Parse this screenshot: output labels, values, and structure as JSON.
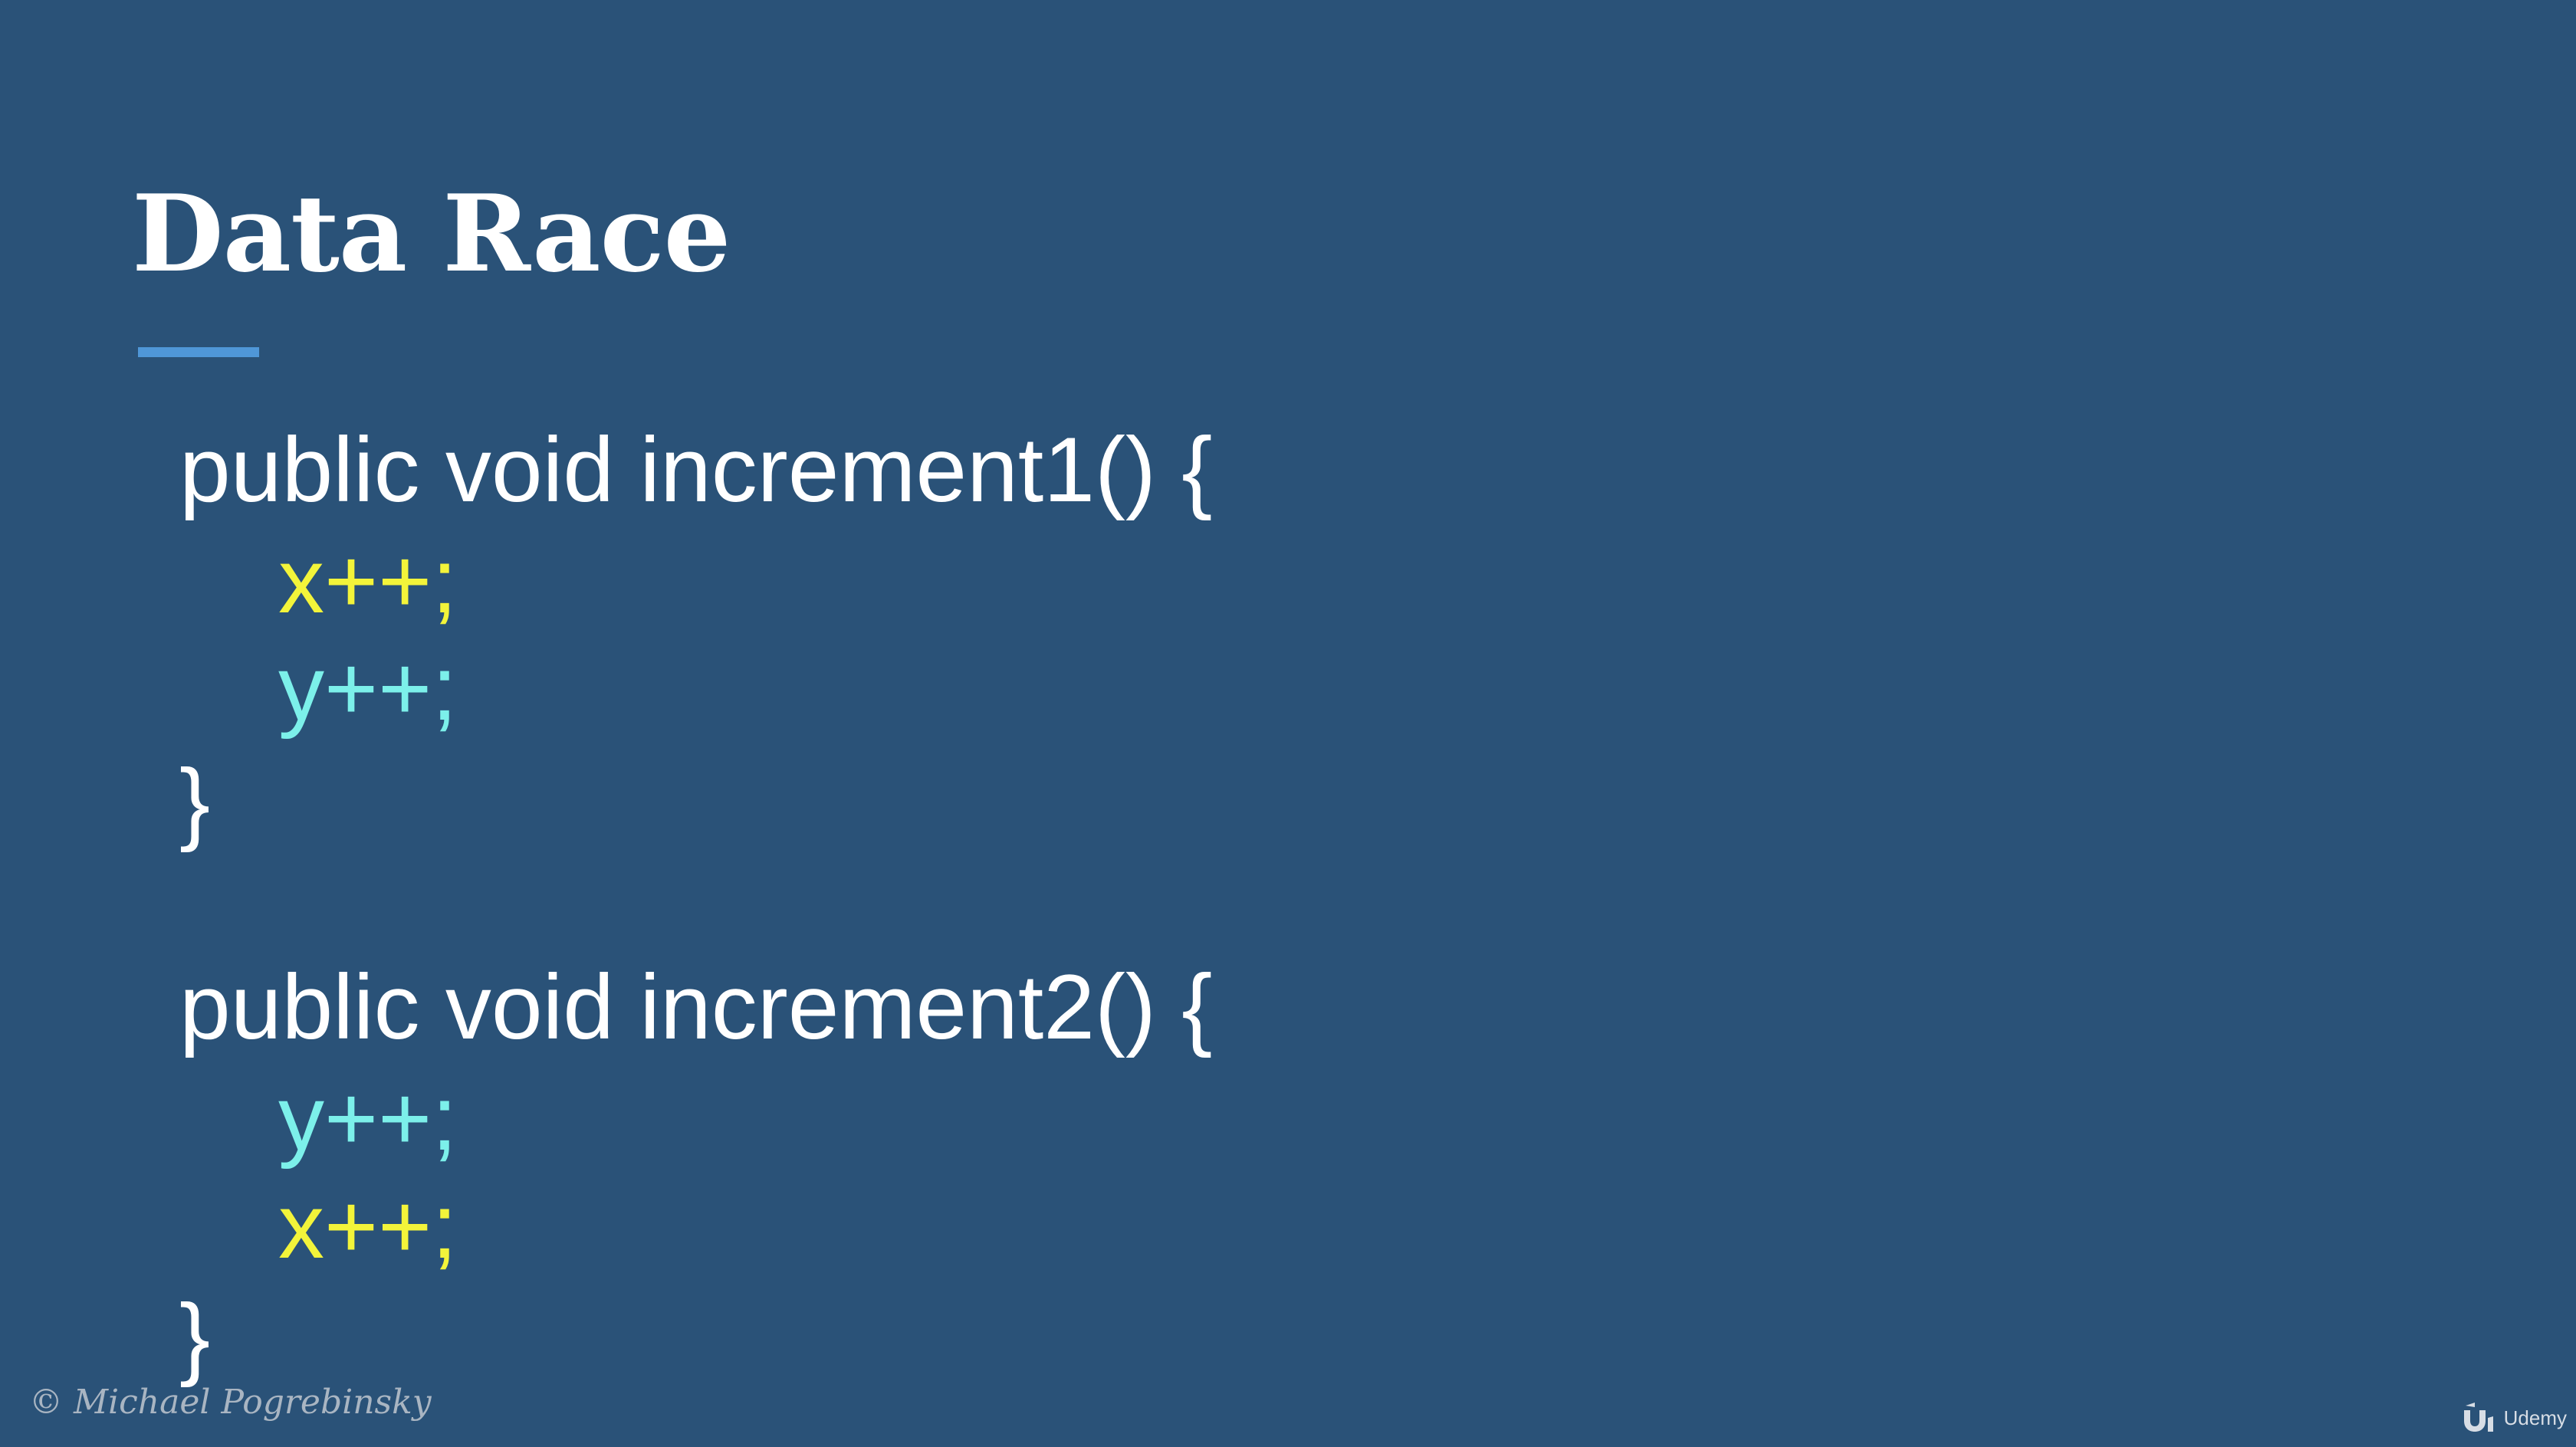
{
  "slide": {
    "title": "Data Race",
    "accent_color": "#4f97d8",
    "background_color": "#2a5278"
  },
  "code": {
    "method1": {
      "signature": "public void increment1() {",
      "lines": [
        {
          "text": "x++;",
          "color": "#f3f43a"
        },
        {
          "text": "y++;",
          "color": "#7cf0ea"
        }
      ],
      "close": "}"
    },
    "method2": {
      "signature": "public void increment2() {",
      "lines": [
        {
          "text": "y++;",
          "color": "#7cf0ea"
        },
        {
          "text": "x++;",
          "color": "#f3f43a"
        }
      ],
      "close": "}"
    }
  },
  "footer": {
    "copyright": "© Michael Pogrebinsky",
    "brand_icon": "udemy-logo-icon",
    "brand_label": "Udemy"
  }
}
